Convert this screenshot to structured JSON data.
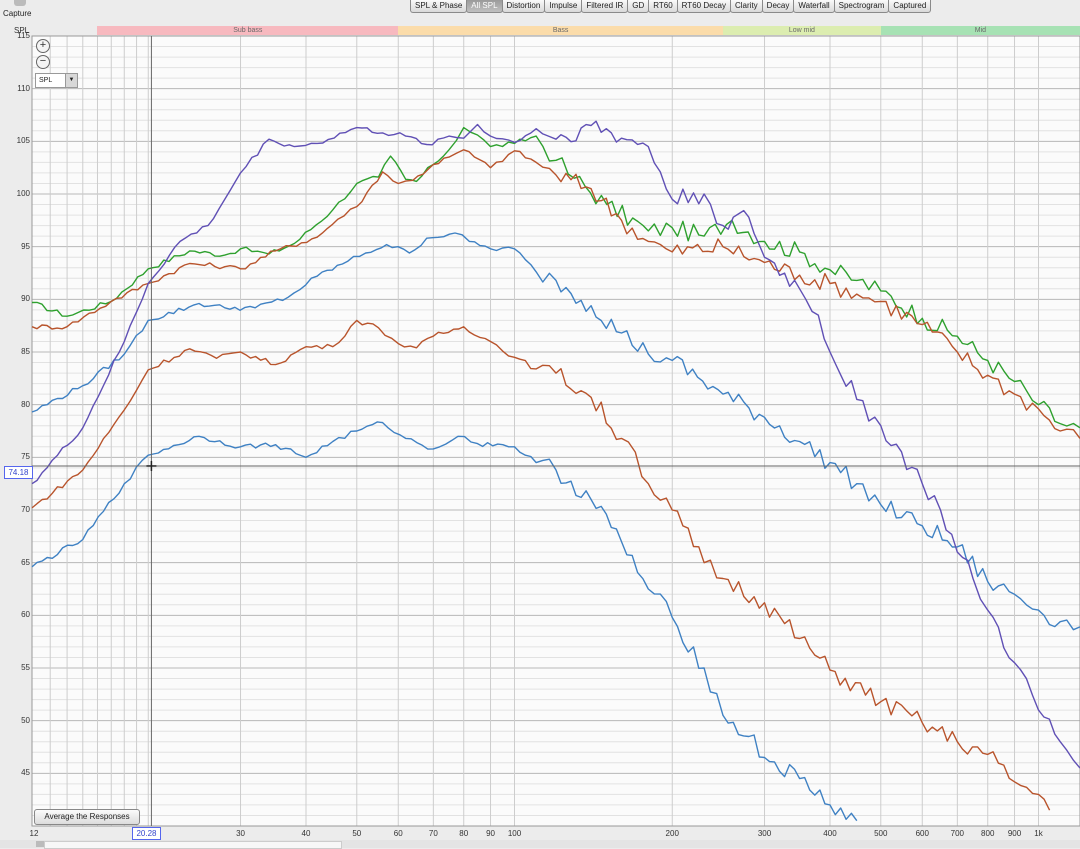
{
  "capture": {
    "label": "Capture",
    "icon": "camera-icon"
  },
  "tabs": [
    {
      "label": "SPL & Phase",
      "active": false
    },
    {
      "label": "All SPL",
      "active": true
    },
    {
      "label": "Distortion",
      "active": false
    },
    {
      "label": "Impulse",
      "active": false
    },
    {
      "label": "Filtered IR",
      "active": false
    },
    {
      "label": "GD",
      "active": false
    },
    {
      "label": "RT60",
      "active": false
    },
    {
      "label": "RT60 Decay",
      "active": false
    },
    {
      "label": "Clarity",
      "active": false
    },
    {
      "label": "Decay",
      "active": false
    },
    {
      "label": "Waterfall",
      "active": false
    },
    {
      "label": "Spectrogram",
      "active": false
    },
    {
      "label": "Captured",
      "active": false
    }
  ],
  "plot": {
    "y_axis_label": "SPL",
    "spl_select": "SPL",
    "average_button": "Average the Responses",
    "cursor_x": "20.28",
    "cursor_y": "74.18"
  },
  "chart_data": {
    "type": "line",
    "xlabel": "",
    "ylabel": "SPL",
    "x_scale": "log",
    "xlim": [
      12,
      1200
    ],
    "ylim": [
      40,
      115
    ],
    "grid": true,
    "y_ticks": [
      45,
      50,
      55,
      60,
      65,
      70,
      75,
      80,
      85,
      90,
      95,
      100,
      105,
      110,
      115
    ],
    "x_ticks": [
      {
        "value": 12,
        "label": "12"
      },
      {
        "value": 30,
        "label": "30"
      },
      {
        "value": 40,
        "label": "40"
      },
      {
        "value": 50,
        "label": "50"
      },
      {
        "value": 60,
        "label": "60"
      },
      {
        "value": 70,
        "label": "70"
      },
      {
        "value": 80,
        "label": "80"
      },
      {
        "value": 90,
        "label": "90"
      },
      {
        "value": 100,
        "label": "100"
      },
      {
        "value": 200,
        "label": "200"
      },
      {
        "value": 300,
        "label": "300"
      },
      {
        "value": 400,
        "label": "400"
      },
      {
        "value": 500,
        "label": "500"
      },
      {
        "value": 600,
        "label": "600"
      },
      {
        "value": 700,
        "label": "700"
      },
      {
        "value": 800,
        "label": "800"
      },
      {
        "value": 900,
        "label": "900"
      },
      {
        "value": 1000,
        "label": "1k"
      }
    ],
    "bands": [
      {
        "label": "Sub bass",
        "from": 16,
        "to": 60,
        "color": "#f7b9bf"
      },
      {
        "label": "Bass",
        "from": 60,
        "to": 250,
        "color": "#fbdcaa"
      },
      {
        "label": "Low mid",
        "from": 250,
        "to": 500,
        "color": "#dcedb0"
      },
      {
        "label": "Mid",
        "from": 500,
        "to": 1200,
        "color": "#a7e2b4"
      }
    ],
    "cursor": {
      "x": 20.28,
      "y": 74.18
    },
    "series": [
      {
        "color": "#2ea02e",
        "points": [
          [
            12,
            89.7
          ],
          [
            14,
            88.4
          ],
          [
            17,
            89.8
          ],
          [
            20,
            92.9
          ],
          [
            24,
            94.6
          ],
          [
            28,
            94.2
          ],
          [
            30,
            94.8
          ],
          [
            34,
            94.3
          ],
          [
            38,
            95.3
          ],
          [
            45,
            98.5
          ],
          [
            50,
            101.0
          ],
          [
            55,
            101.6
          ],
          [
            58,
            103.6
          ],
          [
            62,
            101.4
          ],
          [
            65,
            101.2
          ],
          [
            70,
            102.8
          ],
          [
            75,
            104.2
          ],
          [
            80,
            106.3
          ],
          [
            85,
            105.6
          ],
          [
            90,
            104.5
          ],
          [
            100,
            104.8
          ],
          [
            110,
            105.5
          ],
          [
            120,
            103.2
          ],
          [
            130,
            101.5
          ],
          [
            150,
            99.0
          ],
          [
            180,
            96.5
          ],
          [
            200,
            96.8
          ],
          [
            230,
            96.0
          ],
          [
            260,
            97.5
          ],
          [
            300,
            95.5
          ],
          [
            350,
            94.5
          ],
          [
            400,
            92.8
          ],
          [
            450,
            91.8
          ],
          [
            500,
            90.8
          ],
          [
            600,
            88.2
          ],
          [
            700,
            86.5
          ],
          [
            800,
            84.2
          ],
          [
            900,
            82.2
          ],
          [
            1000,
            80.0
          ],
          [
            1100,
            78.2
          ],
          [
            1200,
            77.8
          ]
        ]
      },
      {
        "color": "#b8542c",
        "points": [
          [
            12,
            87.4
          ],
          [
            14,
            87.4
          ],
          [
            17,
            89.8
          ],
          [
            20,
            91.5
          ],
          [
            24,
            93.4
          ],
          [
            28,
            93.1
          ],
          [
            30,
            92.9
          ],
          [
            35,
            94.6
          ],
          [
            42,
            95.9
          ],
          [
            46,
            97.6
          ],
          [
            50,
            98.8
          ],
          [
            56,
            102.1
          ],
          [
            60,
            101.0
          ],
          [
            64,
            101.3
          ],
          [
            70,
            102.8
          ],
          [
            75,
            103.5
          ],
          [
            80,
            104.2
          ],
          [
            90,
            102.5
          ],
          [
            100,
            104.1
          ],
          [
            110,
            103.0
          ],
          [
            120,
            101.8
          ],
          [
            140,
            100.5
          ],
          [
            160,
            97.5
          ],
          [
            180,
            95.5
          ],
          [
            200,
            94.5
          ],
          [
            250,
            95.0
          ],
          [
            300,
            93.5
          ],
          [
            350,
            92.3
          ],
          [
            400,
            91.5
          ],
          [
            450,
            90.5
          ],
          [
            500,
            89.8
          ],
          [
            600,
            87.6
          ],
          [
            700,
            85.0
          ],
          [
            800,
            82.8
          ],
          [
            900,
            81.0
          ],
          [
            1000,
            79.6
          ],
          [
            1100,
            77.5
          ],
          [
            1200,
            76.8
          ]
        ]
      },
      {
        "color": "#3f81c3",
        "points": [
          [
            12,
            79.3
          ],
          [
            15,
            81.8
          ],
          [
            18,
            84.8
          ],
          [
            20,
            88.0
          ],
          [
            25,
            89.6
          ],
          [
            28,
            89.2
          ],
          [
            32,
            89.2
          ],
          [
            37,
            90.2
          ],
          [
            42,
            92.2
          ],
          [
            48,
            93.6
          ],
          [
            52,
            94.4
          ],
          [
            57,
            95.2
          ],
          [
            63,
            94.4
          ],
          [
            68,
            95.8
          ],
          [
            77,
            96.3
          ],
          [
            82,
            95.5
          ],
          [
            90,
            94.8
          ],
          [
            100,
            94.8
          ],
          [
            110,
            92.6
          ],
          [
            120,
            91.8
          ],
          [
            140,
            89.4
          ],
          [
            160,
            86.8
          ],
          [
            180,
            84.8
          ],
          [
            200,
            84.2
          ],
          [
            250,
            81.0
          ],
          [
            300,
            78.8
          ],
          [
            350,
            76.5
          ],
          [
            400,
            74.5
          ],
          [
            450,
            72.5
          ],
          [
            500,
            70.5
          ],
          [
            600,
            68.5
          ],
          [
            700,
            66.5
          ],
          [
            800,
            63.2
          ],
          [
            900,
            62.0
          ],
          [
            1000,
            60.5
          ],
          [
            1100,
            59.4
          ],
          [
            1200,
            58.9
          ]
        ]
      },
      {
        "color": "#b8542c",
        "points": [
          [
            12,
            70.2
          ],
          [
            15,
            73.8
          ],
          [
            18,
            79.5
          ],
          [
            20,
            83.3
          ],
          [
            24,
            85.3
          ],
          [
            27,
            84.4
          ],
          [
            30,
            85.0
          ],
          [
            35,
            83.8
          ],
          [
            40,
            85.5
          ],
          [
            45,
            85.5
          ],
          [
            50,
            88.0
          ],
          [
            55,
            87.3
          ],
          [
            60,
            85.8
          ],
          [
            65,
            85.4
          ],
          [
            70,
            86.5
          ],
          [
            80,
            87.4
          ],
          [
            90,
            86.0
          ],
          [
            100,
            84.5
          ],
          [
            110,
            83.4
          ],
          [
            120,
            83.0
          ],
          [
            140,
            80.7
          ],
          [
            160,
            76.8
          ],
          [
            170,
            75.5
          ],
          [
            180,
            72.5
          ],
          [
            200,
            70.0
          ],
          [
            230,
            65.0
          ],
          [
            250,
            63.5
          ],
          [
            300,
            61.2
          ],
          [
            350,
            57.8
          ],
          [
            400,
            54.8
          ],
          [
            500,
            51.8
          ],
          [
            600,
            49.8
          ],
          [
            700,
            48.0
          ],
          [
            800,
            46.8
          ],
          [
            900,
            44.2
          ],
          [
            1000,
            43.0
          ],
          [
            1050,
            41.5
          ]
        ]
      },
      {
        "color": "#3f81c3",
        "points": [
          [
            12,
            64.6
          ],
          [
            15,
            67.2
          ],
          [
            18,
            72.5
          ],
          [
            20,
            75.2
          ],
          [
            25,
            77.0
          ],
          [
            30,
            76.0
          ],
          [
            35,
            76.2
          ],
          [
            40,
            75.0
          ],
          [
            45,
            76.5
          ],
          [
            50,
            77.5
          ],
          [
            56,
            78.3
          ],
          [
            62,
            76.8
          ],
          [
            70,
            75.8
          ],
          [
            78,
            77.0
          ],
          [
            85,
            76.3
          ],
          [
            95,
            76.2
          ],
          [
            100,
            76.0
          ],
          [
            110,
            74.5
          ],
          [
            120,
            73.8
          ],
          [
            140,
            71.0
          ],
          [
            160,
            67.0
          ],
          [
            180,
            62.5
          ],
          [
            200,
            59.8
          ],
          [
            230,
            55.0
          ],
          [
            250,
            50.5
          ],
          [
            280,
            48.5
          ],
          [
            300,
            46.5
          ],
          [
            350,
            44.5
          ],
          [
            400,
            42.0
          ],
          [
            450,
            40.5
          ]
        ]
      },
      {
        "color": "#6050b5",
        "points": [
          [
            12,
            72.5
          ],
          [
            15,
            77.8
          ],
          [
            18,
            86.0
          ],
          [
            20,
            91.5
          ],
          [
            23,
            95.5
          ],
          [
            26,
            97.0
          ],
          [
            28,
            99.5
          ],
          [
            30,
            102.0
          ],
          [
            34,
            105.2
          ],
          [
            38,
            104.5
          ],
          [
            42,
            104.8
          ],
          [
            50,
            106.3
          ],
          [
            56,
            105.8
          ],
          [
            62,
            105.5
          ],
          [
            68,
            104.7
          ],
          [
            75,
            105.5
          ],
          [
            80,
            105.3
          ],
          [
            85,
            106.6
          ],
          [
            90,
            105.5
          ],
          [
            100,
            104.9
          ],
          [
            110,
            106.2
          ],
          [
            120,
            105.2
          ],
          [
            140,
            106.5
          ],
          [
            160,
            105.3
          ],
          [
            180,
            104.5
          ],
          [
            200,
            99.5
          ],
          [
            230,
            100.0
          ],
          [
            250,
            97.0
          ],
          [
            280,
            97.8
          ],
          [
            300,
            94.0
          ],
          [
            350,
            91.0
          ],
          [
            380,
            88.5
          ],
          [
            400,
            85.0
          ],
          [
            450,
            80.5
          ],
          [
            500,
            78.0
          ],
          [
            600,
            72.5
          ],
          [
            650,
            70.0
          ],
          [
            700,
            66.0
          ],
          [
            750,
            63.5
          ],
          [
            800,
            60.5
          ],
          [
            900,
            55.5
          ],
          [
            1000,
            51.0
          ],
          [
            1100,
            48.0
          ],
          [
            1200,
            45.5
          ]
        ]
      }
    ]
  }
}
